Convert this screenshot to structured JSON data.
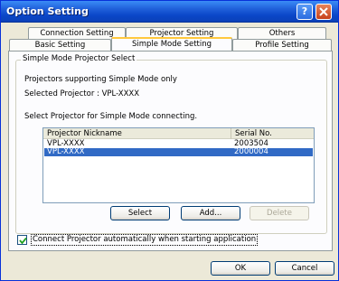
{
  "window": {
    "title": "Option Setting"
  },
  "tabs_back_row": [
    "Connection Setting",
    "Projector Setting",
    "Others"
  ],
  "tabs_front_row": [
    "Basic Setting",
    "Simple Mode Setting",
    "Profile Setting"
  ],
  "selected_tab": "Simple Mode Setting",
  "group": {
    "label": "Simple Mode Projector Select",
    "supporting_text": "Projectors supporting Simple Mode only",
    "selected_projector": "Selected Projector : VPL-XXXX",
    "instruction": "Select Projector for Simple Mode connecting."
  },
  "list": {
    "columns": [
      "Projector Nickname",
      "Serial No."
    ],
    "rows": [
      {
        "nickname": "VPL-XXXX",
        "serial": "2003504"
      },
      {
        "nickname": "VPL-XXXX",
        "serial": "2000004"
      }
    ],
    "selected_row_index": 1
  },
  "buttons": {
    "select": "Select",
    "add": "Add...",
    "delete": "Delete",
    "ok": "OK",
    "cancel": "Cancel"
  },
  "auto_connect": {
    "label": "Connect Projector automatically when starting application",
    "checked": true
  },
  "colors": {
    "titlebar": "#0a46c8",
    "selection": "#316ac5",
    "tab_highlight": "#ffc83c"
  }
}
